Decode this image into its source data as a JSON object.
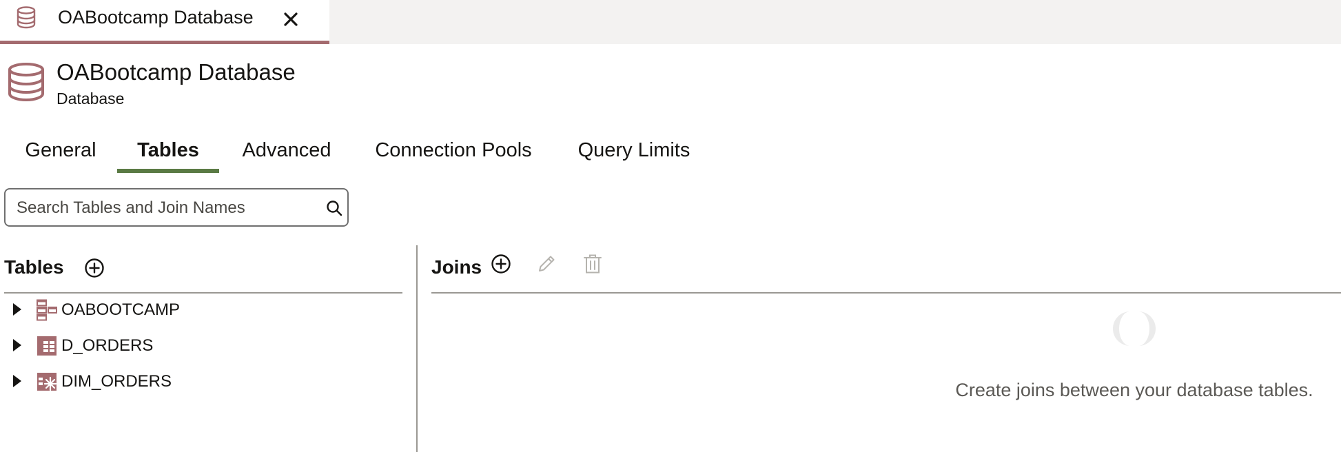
{
  "document_tab": {
    "title": "OABootcamp Database",
    "icon": "database-icon",
    "close_icon": "close-icon"
  },
  "header": {
    "title": "OABootcamp Database",
    "subtitle": "Database",
    "icon": "database-icon"
  },
  "tabs": [
    {
      "label": "General",
      "active": false
    },
    {
      "label": "Tables",
      "active": true
    },
    {
      "label": "Advanced",
      "active": false
    },
    {
      "label": "Connection Pools",
      "active": false
    },
    {
      "label": "Query Limits",
      "active": false
    }
  ],
  "search": {
    "placeholder": "Search Tables and Join Names",
    "value": ""
  },
  "tables_panel": {
    "heading": "Tables",
    "items": [
      {
        "label": "OABOOTCAMP",
        "icon": "schema-icon"
      },
      {
        "label": "D_ORDERS",
        "icon": "table-icon"
      },
      {
        "label": "DIM_ORDERS",
        "icon": "dimension-table-icon"
      }
    ]
  },
  "joins_panel": {
    "heading": "Joins",
    "empty_message": "Create joins between your database tables."
  },
  "colors": {
    "accent": "#a46b6f",
    "active_tab_underline": "#5a7a44",
    "text": "#161513",
    "muted_text": "#5b5955"
  }
}
